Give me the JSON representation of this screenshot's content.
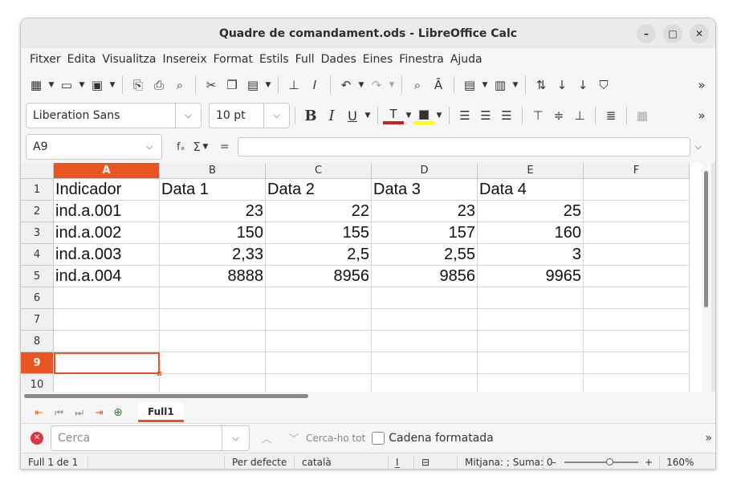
{
  "window": {
    "title": "Quadre de comandament.ods - LibreOffice Calc",
    "buttons": [
      "–",
      "□",
      "✕"
    ]
  },
  "menu": [
    "Fitxer",
    "Edita",
    "Visualitza",
    "Insereix",
    "Format",
    "Estils",
    "Full",
    "Dades",
    "Eines",
    "Finestra",
    "Ajuda"
  ],
  "toolbar2": {
    "font_name": "Liberation Sans",
    "font_size": "10 pt",
    "bold": "B",
    "italic": "I",
    "underline": "U"
  },
  "formula_bar": {
    "name_box": "A9",
    "fx_label": "fₓ",
    "sigma_label": "Σ",
    "equals_label": "=",
    "formula": ""
  },
  "grid": {
    "columns": [
      "A",
      "B",
      "C",
      "D",
      "E",
      "F"
    ],
    "active_column": "A",
    "rows": [
      "1",
      "2",
      "3",
      "4",
      "5",
      "6",
      "7",
      "8",
      "9",
      "10"
    ],
    "active_row": "9",
    "cells": [
      [
        "Indicador",
        "Data 1",
        "Data 2",
        "Data 3",
        "Data 4",
        ""
      ],
      [
        "ind.a.001",
        "23",
        "22",
        "23",
        "25",
        ""
      ],
      [
        "ind.a.002",
        "150",
        "155",
        "157",
        "160",
        ""
      ],
      [
        "ind.a.003",
        "2,33",
        "2,5",
        "2,55",
        "3",
        ""
      ],
      [
        "ind.a.004",
        "8888",
        "8956",
        "9856",
        "9965",
        ""
      ],
      [
        "",
        "",
        "",
        "",
        "",
        ""
      ],
      [
        "",
        "",
        "",
        "",
        "",
        ""
      ],
      [
        "",
        "",
        "",
        "",
        "",
        ""
      ],
      [
        "",
        "",
        "",
        "",
        "",
        ""
      ],
      [
        "",
        "",
        "",
        "",
        "",
        ""
      ]
    ]
  },
  "sheet_tabs": {
    "tabs": [
      "Full1"
    ],
    "active": "Full1"
  },
  "find_bar": {
    "placeholder": "Cerca",
    "find_all": "Cerca-ho tot",
    "formatted_label": "Cadena formatada"
  },
  "status_bar": {
    "sheet": "Full 1 de 1",
    "page_style": "Per defecte",
    "language": "català",
    "selection_mode": "I̲",
    "summary": "Mitjana: ; Suma: 0",
    "zoom_minus": "–",
    "zoom_plus": "+",
    "zoom": "160%"
  },
  "colors": {
    "accent": "#e95420"
  }
}
